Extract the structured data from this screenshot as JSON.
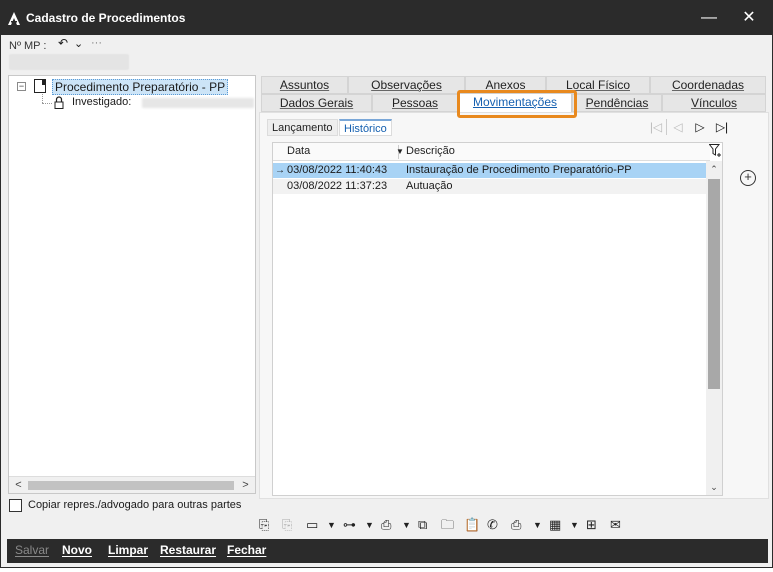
{
  "window": {
    "title": "Cadastro de Procedimentos",
    "minimize_glyph": "—",
    "close_glyph": "✕"
  },
  "mp": {
    "label": "Nº MP :",
    "undo_glyph": "↶",
    "chevron_glyph": "⌄",
    "more_glyph": "···"
  },
  "tree": {
    "expander_glyph": "−",
    "root_label": "Procedimento Preparatório - PP",
    "child_label": "Investigado:",
    "scroll_left": "<",
    "scroll_right": ">"
  },
  "copy": {
    "label": "Copiar repres./advogado para outras partes",
    "checked": false
  },
  "tabs_row1": [
    "Assuntos",
    "Observações",
    "Anexos",
    "Local Físico",
    "Coordenadas"
  ],
  "tabs_row2": [
    "Dados Gerais",
    "Pessoas",
    "Movimentações",
    "Pendências",
    "Vínculos"
  ],
  "active_tab": "Movimentações",
  "subtabs": {
    "launch": "Lançamento",
    "history": "Histórico",
    "active": "Histórico"
  },
  "nav": {
    "first": "|◁",
    "prev": "◁",
    "next": "▷",
    "last": "▷|"
  },
  "grid": {
    "columns": {
      "date": "Data",
      "description": "Descrição",
      "sort_glyph": "▼"
    },
    "rows": [
      {
        "marker": "→",
        "date": "03/08/2022 11:40:43",
        "description": "Instauração de Procedimento Preparatório-PP",
        "selected": true
      },
      {
        "marker": "",
        "date": "03/08/2022 11:37:23",
        "description": "Autuação",
        "selected": false
      }
    ],
    "scroll_up": "⌃",
    "scroll_down": "⌄",
    "add_glyph": "+"
  },
  "toolbar": {
    "icons": [
      "add-doc-icon",
      "copy-doc-icon",
      "window-icon",
      "hierarchy-icon",
      "print-doc-icon",
      "documents-icon",
      "folder-icon",
      "clipboard-icon",
      "phone-icon",
      "printer-icon",
      "calendar-icon",
      "text-doc-icon",
      "mail-folder-icon"
    ],
    "glyphs": {
      "add_doc": "⎘",
      "copy_doc": "⎘",
      "window": "▭",
      "hierarchy": "⊶",
      "print_doc": "⎙",
      "documents": "⧉",
      "folder": "🗀",
      "clipboard": "📋",
      "phone": "✆",
      "printer": "⎙",
      "calendar": "▦",
      "text_doc": "⊞",
      "mail_folder": "✉",
      "dropdown": "▼"
    }
  },
  "bottom": {
    "save": "Salvar",
    "new": "Novo",
    "clear": "Limpar",
    "restore": "Restaurar",
    "close": "Fechar"
  },
  "colors": {
    "titlebar": "#2b2b2b",
    "selection": "#a8d3f5",
    "accent": "#1560b0",
    "highlight": "#e8891e"
  }
}
